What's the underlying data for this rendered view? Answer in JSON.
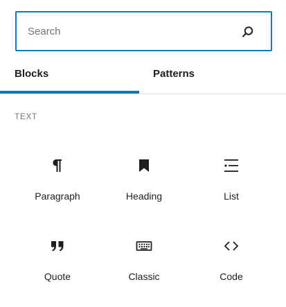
{
  "search": {
    "placeholder": "Search",
    "value": ""
  },
  "tabs": [
    {
      "label": "Blocks",
      "active": true
    },
    {
      "label": "Patterns",
      "active": false
    }
  ],
  "colors": {
    "accent": "#007cba",
    "text": "#1e1e1e",
    "muted": "#757575",
    "divider": "#e0e0e0"
  },
  "section": {
    "title": "TEXT"
  },
  "blocks": [
    {
      "label": "Paragraph",
      "icon": "paragraph-icon"
    },
    {
      "label": "Heading",
      "icon": "bookmark-icon"
    },
    {
      "label": "List",
      "icon": "list-icon"
    },
    {
      "label": "Quote",
      "icon": "quote-icon"
    },
    {
      "label": "Classic",
      "icon": "keyboard-icon"
    },
    {
      "label": "Code",
      "icon": "code-icon"
    }
  ]
}
